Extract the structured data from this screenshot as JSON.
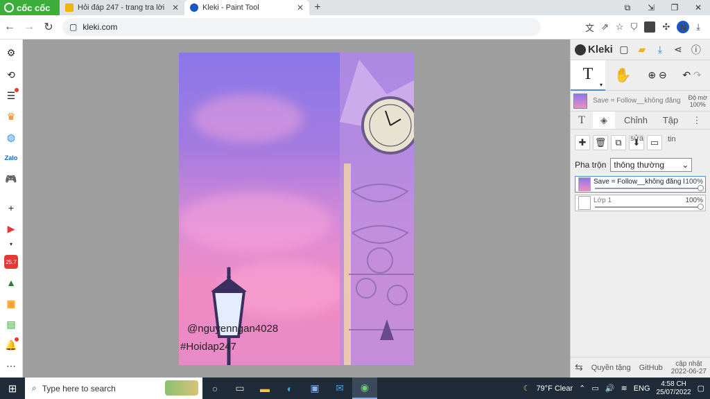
{
  "browser": {
    "brand": "cốc cốc",
    "tabs": [
      {
        "title": "Hỏi đáp 247 - trang tra lời",
        "active": false
      },
      {
        "title": "Kleki - Paint Tool",
        "active": true
      }
    ],
    "new_tab": "+",
    "url": "kleki.com",
    "profile_initial": "N"
  },
  "canvas": {
    "watermark_handle": "@nguyenngan4028",
    "watermark_tag": "#Hoidap247"
  },
  "kleki": {
    "brand": "Kleki",
    "tool_text": "T",
    "document": {
      "name": "Save = Follow__không đăng",
      "opacity_label": "Độ mờ",
      "opacity_value": "100%"
    },
    "tabs": [
      "T",
      "Chỉnh",
      "Tập"
    ],
    "more": "⋮",
    "action_labels": {
      "rename_a": "sửa",
      "rename_b": "tin"
    },
    "blend": {
      "label": "Pha trộn",
      "value": "thông thường"
    },
    "layers": [
      {
        "name": "Save = Follow__không đăng l",
        "opacity": "100%",
        "opacity_fraction": 1.0,
        "active": true
      },
      {
        "name": "Lớp 1",
        "opacity": "100%",
        "opacity_fraction": 1.0,
        "active": false
      }
    ],
    "footer": {
      "license": "Quyền tặng",
      "github": "GitHub",
      "updated_label": "cập nhật",
      "updated_date": "2022-06-27"
    }
  },
  "taskbar": {
    "search_placeholder": "Type here to search",
    "weather": "79°F  Clear",
    "lang": "ENG",
    "time": "4:58 CH",
    "date": "25/07/2022"
  },
  "colors": {
    "coccoc_green": "#3cae3c",
    "active_accent": "#4a8fe7",
    "taskbar": "#1f2b38"
  }
}
